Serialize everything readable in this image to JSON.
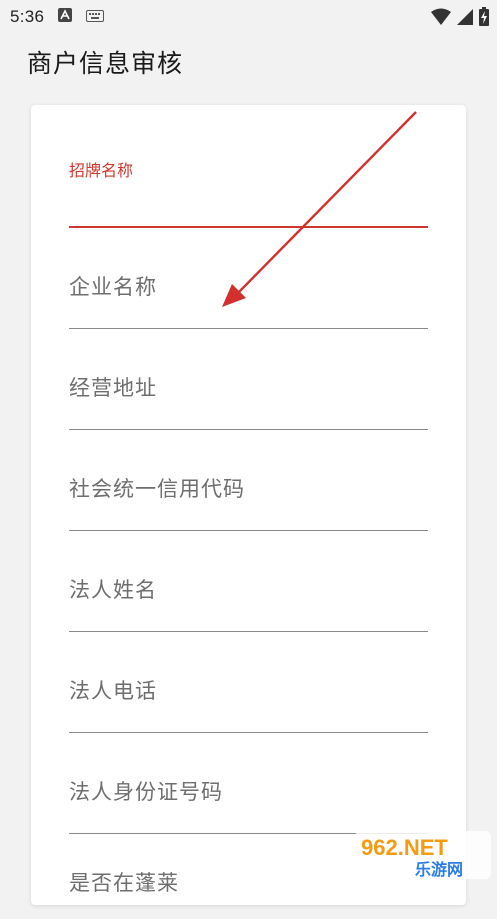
{
  "status_bar": {
    "time": "5:36",
    "icons": [
      "a-badge-icon",
      "keyboard-icon",
      "wifi-icon",
      "signal-icon",
      "battery-charging-icon"
    ]
  },
  "header": {
    "title": "商户信息审核"
  },
  "form": {
    "active_field": {
      "label": "招牌名称",
      "value": ""
    },
    "fields": [
      {
        "placeholder": "企业名称"
      },
      {
        "placeholder": "经营地址"
      },
      {
        "placeholder": "社会统一信用代码"
      },
      {
        "placeholder": "法人姓名"
      },
      {
        "placeholder": "法人电话"
      },
      {
        "placeholder": "法人身份证号码"
      },
      {
        "placeholder": "是否在蓬莱"
      }
    ]
  },
  "colors": {
    "accent": "#d0372e",
    "annotation_arrow": "#d32f2f",
    "background": "#f2f2f2",
    "card": "#ffffff"
  },
  "watermark": {
    "text_top": "962.NET",
    "text_bottom": "乐游网"
  }
}
